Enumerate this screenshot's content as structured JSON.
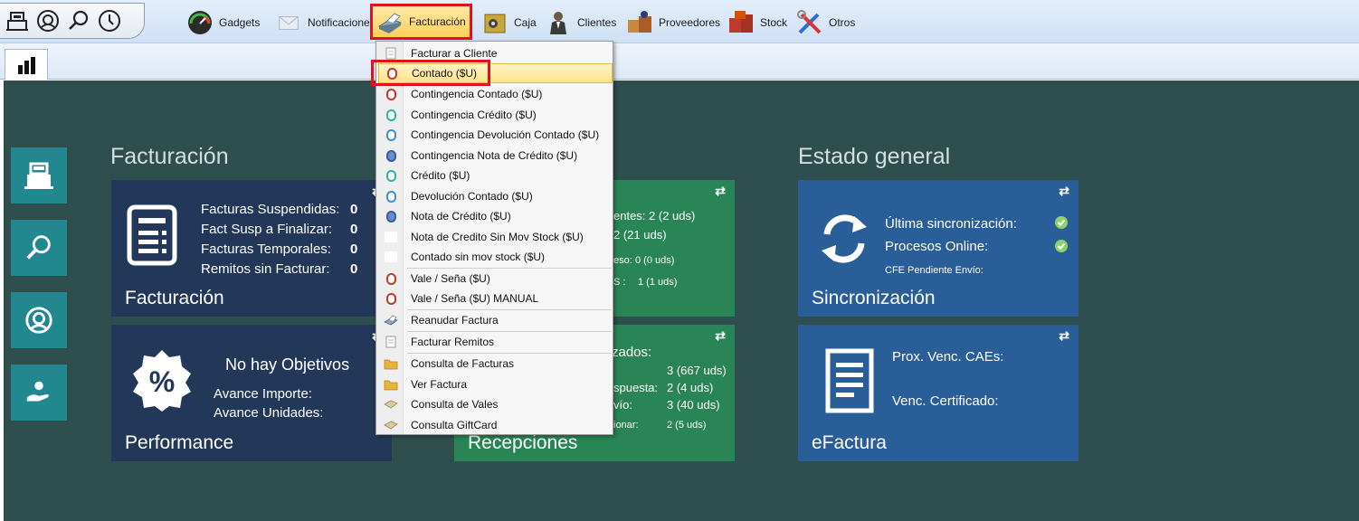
{
  "toolbar": {
    "quick_icons": [
      "cash-register-icon",
      "support-agent-icon",
      "search-icon",
      "clock-icon"
    ],
    "items": [
      {
        "label": "Gadgets",
        "icon": "gauge-icon"
      },
      {
        "label": "Notificaciones",
        "icon": "envelope-icon"
      },
      {
        "label": "Facturación",
        "icon": "printer-icon",
        "active": true
      },
      {
        "label": "Caja",
        "icon": "safe-icon"
      },
      {
        "label": "Clientes",
        "icon": "person-icon"
      },
      {
        "label": "Proveedores",
        "icon": "supplier-icon"
      },
      {
        "label": "Stock",
        "icon": "boxes-icon"
      },
      {
        "label": "Otros",
        "icon": "tools-icon"
      }
    ]
  },
  "tabs": [
    {
      "icon": "bar-chart-icon"
    }
  ],
  "sidebar": [
    "cash-register-icon",
    "search-icon",
    "support-agent-icon",
    "money-hand-icon"
  ],
  "sections": {
    "facturacion_title": "Facturación",
    "estado_title": "Estado general"
  },
  "tiles": {
    "facturacion": {
      "name": "Facturación",
      "rows": [
        {
          "label": "Facturas Suspendidas:",
          "value": "0"
        },
        {
          "label": "Fact Susp a Finalizar:",
          "value": "0"
        },
        {
          "label": "Facturas Temporales:",
          "value": "0"
        },
        {
          "label": "Remitos sin Facturar:",
          "value": "0"
        }
      ]
    },
    "performance": {
      "name": "Performance",
      "headline": "No hay Objetivos",
      "row1": "Avance Importe:",
      "row2": "Avance Unidades:"
    },
    "green_top": {
      "line1": "entes: 2 (2 uds)",
      "line2": "2 (21 uds)",
      "line3_label": "eso:",
      "line3_value": "0 (0 uds)",
      "line4_label": "S :",
      "line4_value": "1 (1 uds)"
    },
    "recepciones": {
      "name": "Recepciones",
      "header": "zados:",
      "r1_value": "3 (667 uds)",
      "r2_label": "spuesta:",
      "r2_value": "2 (4 uds)",
      "r3_label": "vío:",
      "r3_value": "3 (40 uds)",
      "r4_label": "ionar:",
      "r4_value": "2 (5 uds)"
    },
    "sincronizacion": {
      "name": "Sincronización",
      "row1": "Última sincronización:",
      "row2": "Procesos Online:",
      "row3": "CFE Pendiente Envío:"
    },
    "efactura": {
      "name": "eFactura",
      "row1": "Prox. Venc. CAEs:",
      "row2": "Venc. Certificado:"
    }
  },
  "menu": {
    "items": [
      {
        "label": "Facturar a Cliente",
        "icon": "document-icon"
      },
      {
        "label": "Contado ($U)",
        "icon": "red-pill-icon",
        "highlighted": true
      },
      {
        "label": "Contingencia Contado ($U)",
        "icon": "red-pill-icon"
      },
      {
        "label": "Contingencia Crédito ($U)",
        "icon": "teal-pill-icon"
      },
      {
        "label": "Contingencia Devolución Contado ($U)",
        "icon": "blue-pill-icon"
      },
      {
        "label": "Contingencia Nota de Crédito ($U)",
        "icon": "navy-pill-icon"
      },
      {
        "label": "Crédito ($U)",
        "icon": "teal-pill-icon"
      },
      {
        "label": "Devolución Contado ($U)",
        "icon": "blue-pill-icon"
      },
      {
        "label": "Nota de Crédito ($U)",
        "icon": "navy-pill-icon"
      },
      {
        "label": "Nota de Credito Sin Mov Stock ($U)",
        "icon": "blank-icon"
      },
      {
        "label": "Contado sin mov stock ($U)",
        "icon": "blank-icon"
      },
      {
        "label": "Vale / Seña ($U)",
        "icon": "red-pill-icon"
      },
      {
        "label": "Vale / Seña ($U) MANUAL",
        "icon": "red-pill-icon"
      },
      {
        "label": "Reanudar Factura",
        "icon": "printer-icon"
      },
      {
        "label": "Facturar Remitos",
        "icon": "document-icon"
      },
      {
        "label": "Consulta de Facturas",
        "icon": "folder-icon"
      },
      {
        "label": "Ver Factura",
        "icon": "folder-icon"
      },
      {
        "label": "Consulta de Vales",
        "icon": "card-icon"
      },
      {
        "label": "Consulta GiftCard",
        "icon": "card-icon"
      }
    ]
  },
  "colors": {
    "accent_red": "#e0121b",
    "dashboard_bg": "#2e4f4e",
    "tile_navy": "#233858",
    "tile_green": "#2a8556",
    "tile_blue": "#2a5e98"
  }
}
